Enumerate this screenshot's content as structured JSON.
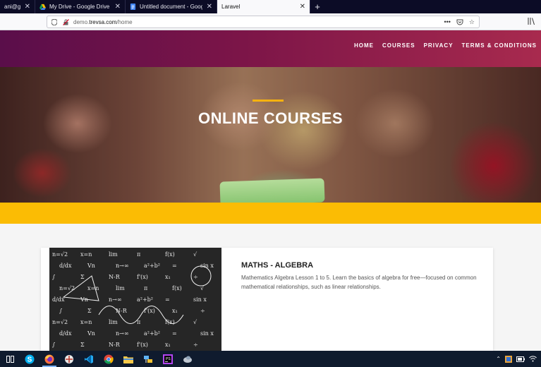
{
  "browser": {
    "tabs": [
      {
        "title": "ani@gmai",
        "icon": "mail-icon",
        "active": false
      },
      {
        "title": "My Drive - Google Drive",
        "icon": "google-drive-icon",
        "active": false
      },
      {
        "title": "Untitled document - Google Do",
        "icon": "google-docs-icon",
        "active": false
      },
      {
        "title": "Laravel",
        "icon": "",
        "active": true
      }
    ],
    "new_tab_label": "+",
    "url_prefix": "demo.",
    "url_host": "trevsa.com",
    "url_path": "/home",
    "more_label": "•••"
  },
  "site": {
    "nav": [
      "HOME",
      "COURSES",
      "PRIVACY",
      "TERMS & CONDITIONS"
    ],
    "hero_title": "ONLINE COURSES",
    "accent_color": "#fbbc04",
    "header_gradient": [
      "#5a0e4a",
      "#a82a4e"
    ]
  },
  "course": {
    "title": "MATHS - ALGEBRA",
    "description": "Mathematics Algebra Lesson 1 to 5. Learn the basics of algebra for free—focused on common mathematical relationships, such as linear relationships.",
    "image_icon": "chalkboard-math-image",
    "chalk_formulas": [
      "n=√2",
      "x=n",
      "lim",
      "π",
      "f(x)",
      "√",
      "d/dx",
      "Vn",
      "n→∞",
      "a²+b²",
      "=",
      "sin x",
      "∫",
      "Σ",
      "N-R",
      "f'(x)",
      "x₁",
      "÷"
    ]
  },
  "taskbar": {
    "items": [
      "task-view-icon",
      "skype-icon",
      "firefox-icon",
      "snip-icon",
      "vscode-icon",
      "chrome-icon",
      "file-explorer-icon",
      "network-tool-icon",
      "phpstorm-icon",
      "misc-app-icon"
    ],
    "active_index": 2,
    "tray": [
      "chevron-up-icon",
      "app-tray-icon",
      "battery-icon",
      "wifi-icon"
    ]
  }
}
